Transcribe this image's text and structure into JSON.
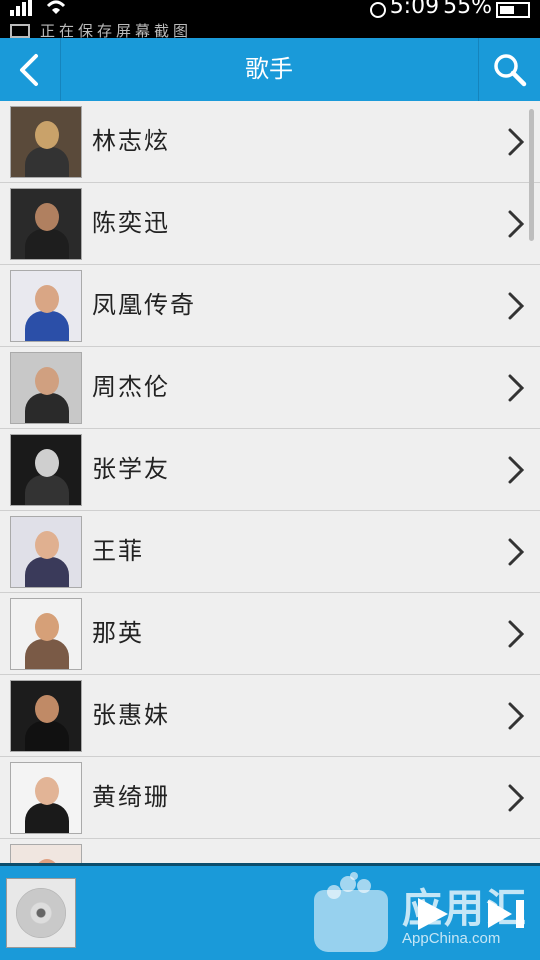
{
  "status_bar": {
    "time": "5:09",
    "battery": "55%",
    "notification_text": "正在保存屏幕截图"
  },
  "header": {
    "title": "歌手",
    "back_icon": "chevron-left-icon",
    "search_icon": "search-icon",
    "accent_color": "#1a9ad9"
  },
  "artists": [
    {
      "name": "林志炫",
      "avatar_colors": [
        "#5a4a3a",
        "#c9a26a",
        "#333"
      ]
    },
    {
      "name": "陈奕迅",
      "avatar_colors": [
        "#2a2a2a",
        "#b08060",
        "#1e1e1e"
      ]
    },
    {
      "name": "凤凰传奇",
      "avatar_colors": [
        "#e9e9ef",
        "#d9a685",
        "#2b4fa8"
      ]
    },
    {
      "name": "周杰伦",
      "avatar_colors": [
        "#c8c8c8",
        "#d0a080",
        "#2a2a2a"
      ]
    },
    {
      "name": "张学友",
      "avatar_colors": [
        "#1a1a1a",
        "#cfcfcf",
        "#333"
      ]
    },
    {
      "name": "王菲",
      "avatar_colors": [
        "#e0e0e8",
        "#e0b090",
        "#3a3a5a"
      ]
    },
    {
      "name": "那英",
      "avatar_colors": [
        "#f2f2f2",
        "#d6a078",
        "#7a5a46"
      ]
    },
    {
      "name": "张惠妹",
      "avatar_colors": [
        "#1c1c1c",
        "#c08a66",
        "#111"
      ]
    },
    {
      "name": "黄绮珊",
      "avatar_colors": [
        "#f4f4f4",
        "#e2b496",
        "#1a1a1a"
      ]
    },
    {
      "name": "",
      "avatar_colors": [
        "#f0e6e0",
        "#e0a080",
        "#ccc"
      ]
    }
  ],
  "player": {
    "disc_icon": "cd-disc-icon",
    "play_icon": "play-icon",
    "next_icon": "next-track-icon",
    "watermark": "应用汇",
    "watermark_sub": "AppChina.com"
  }
}
